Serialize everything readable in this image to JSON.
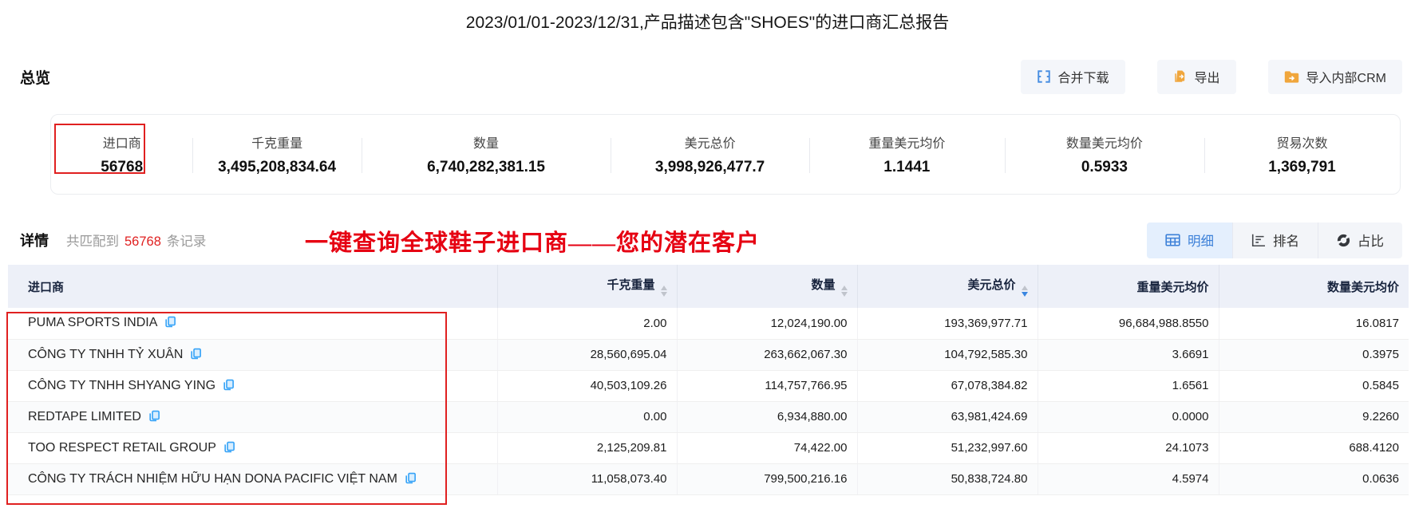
{
  "title": "2023/01/01-2023/12/31,产品描述包含\"SHOES\"的进口商汇总报告",
  "overview": {
    "heading": "总览",
    "buttons": [
      {
        "label": "合并下载",
        "icon": "merge-download-icon",
        "icon_color": "#4a8fe2"
      },
      {
        "label": "导出",
        "icon": "export-icon",
        "icon_color": "#f0a63c"
      },
      {
        "label": "导入内部CRM",
        "icon": "import-folder-icon",
        "icon_color": "#f0a63c"
      }
    ],
    "stats": [
      {
        "label": "进口商",
        "value": "56768",
        "highlighted": true
      },
      {
        "label": "千克重量",
        "value": "3,495,208,834.64"
      },
      {
        "label": "数量",
        "value": "6,740,282,381.15"
      },
      {
        "label": "美元总价",
        "value": "3,998,926,477.7"
      },
      {
        "label": "重量美元均价",
        "value": "1.1441"
      },
      {
        "label": "数量美元均价",
        "value": "0.5933"
      },
      {
        "label": "贸易次数",
        "value": "1,369,791"
      }
    ]
  },
  "detail": {
    "heading": "详情",
    "match_prefix": "共匹配到",
    "match_count": "56768",
    "match_suffix": "条记录",
    "annotation": "一键查询全球鞋子进口商——您的潜在客户",
    "annotation_color": "#e60012",
    "view_tabs": [
      {
        "label": "明细",
        "icon": "table-grid-icon",
        "active": true
      },
      {
        "label": "排名",
        "icon": "ranking-bars-icon",
        "active": false
      },
      {
        "label": "占比",
        "icon": "donut-chart-icon",
        "active": false
      }
    ]
  },
  "table": {
    "columns": [
      {
        "label": "进口商",
        "sortable": false
      },
      {
        "label": "千克重量",
        "sortable": true,
        "sort": "none"
      },
      {
        "label": "数量",
        "sortable": true,
        "sort": "none"
      },
      {
        "label": "美元总价",
        "sortable": true,
        "sort": "desc"
      },
      {
        "label": "重量美元均价",
        "sortable": false
      },
      {
        "label": "数量美元均价",
        "sortable": false
      }
    ],
    "rows": [
      {
        "name": "PUMA SPORTS INDIA",
        "values": [
          "2.00",
          "12,024,190.00",
          "193,369,977.71",
          "96,684,988.8550",
          "16.0817"
        ]
      },
      {
        "name": "CÔNG TY TNHH TỶ XUÂN",
        "values": [
          "28,560,695.04",
          "263,662,067.30",
          "104,792,585.30",
          "3.6691",
          "0.3975"
        ]
      },
      {
        "name": "CÔNG TY TNHH SHYANG YING",
        "values": [
          "40,503,109.26",
          "114,757,766.95",
          "67,078,384.82",
          "1.6561",
          "0.5845"
        ]
      },
      {
        "name": "REDTAPE LIMITED",
        "values": [
          "0.00",
          "6,934,880.00",
          "63,981,424.69",
          "0.0000",
          "9.2260"
        ]
      },
      {
        "name": "TOO RESPECT RETAIL GROUP",
        "values": [
          "2,125,209.81",
          "74,422.00",
          "51,232,997.60",
          "24.1073",
          "688.4120"
        ]
      },
      {
        "name": "CÔNG TY TRÁCH NHIỆM HỮU HẠN DONA PACIFIC VIỆT NAM",
        "values": [
          "11,058,073.40",
          "799,500,216.16",
          "50,838,724.80",
          "4.5974",
          "0.0636"
        ]
      }
    ]
  },
  "colors": {
    "accent_blue": "#3c80d8",
    "highlight_red": "#e02020",
    "header_bg": "#edf0f8",
    "button_bg": "#f4f6fa",
    "active_tab_bg": "#e4effd"
  }
}
